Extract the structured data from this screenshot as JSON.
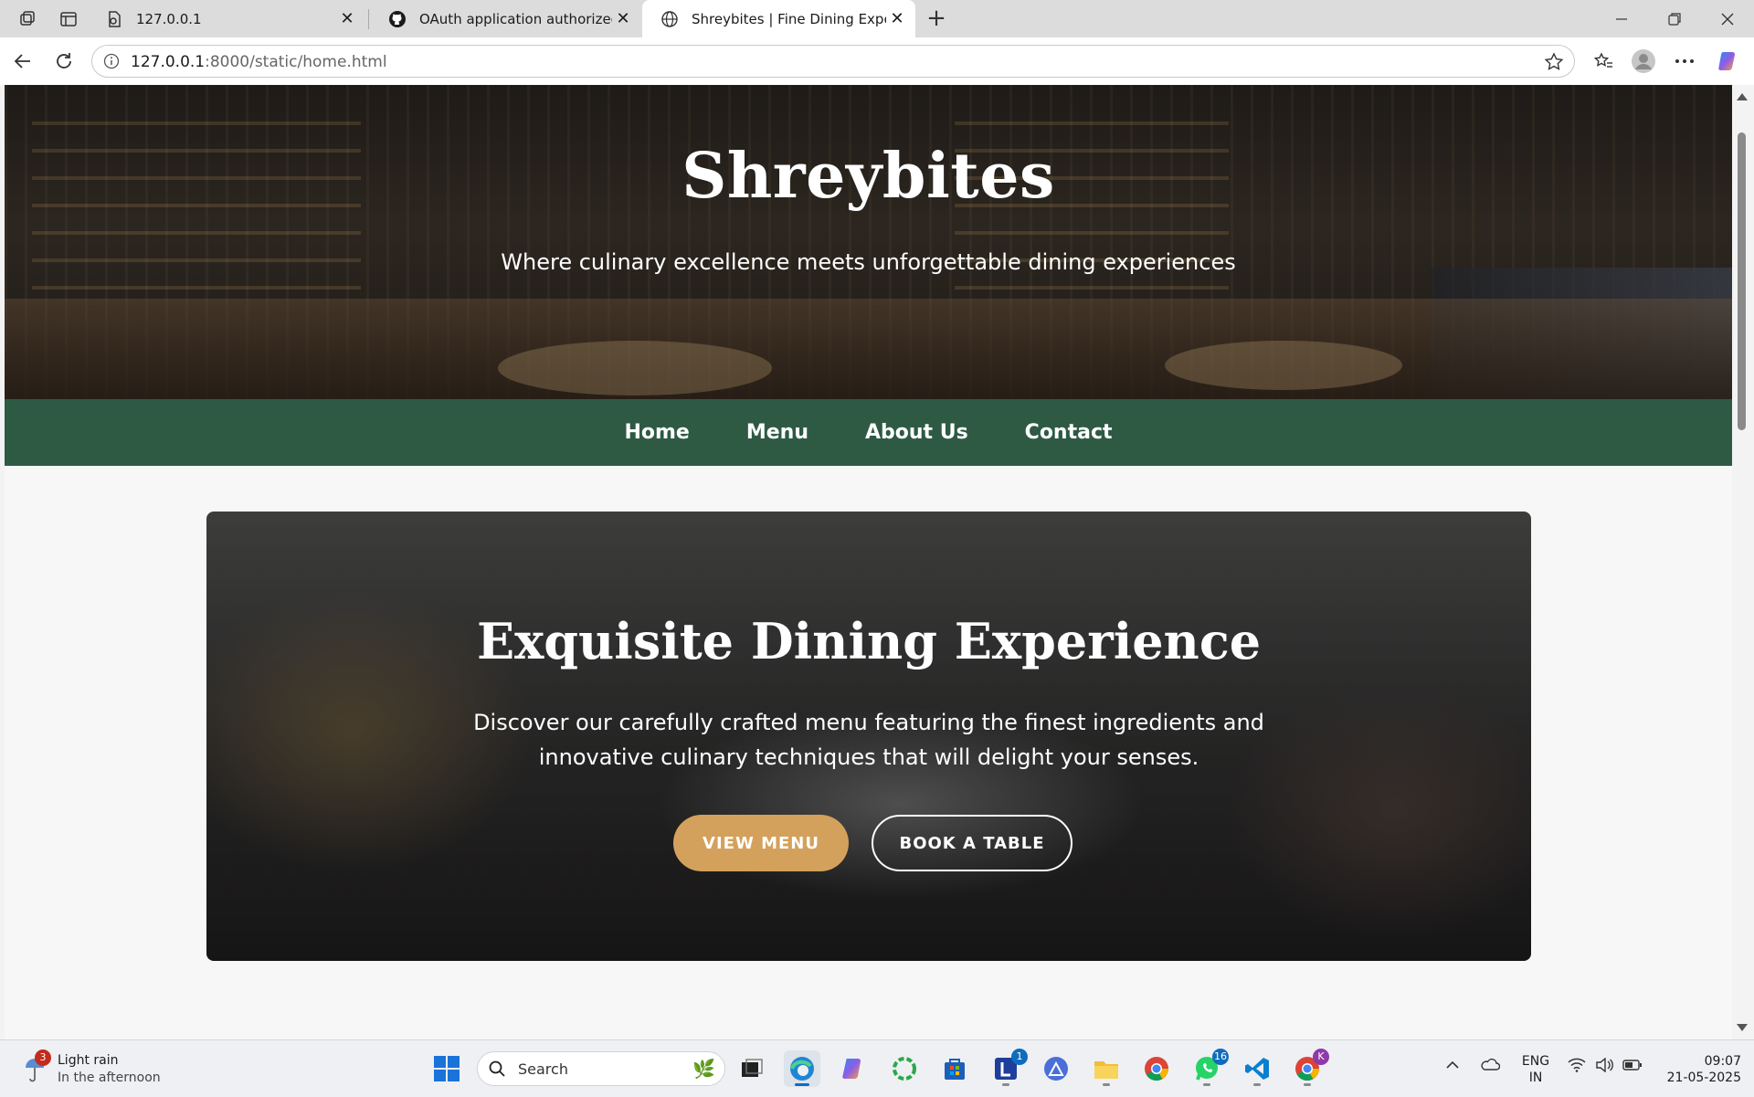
{
  "browser": {
    "tabs": [
      {
        "title": "127.0.0.1",
        "icon": "pdf-document-icon"
      },
      {
        "title": "OAuth application authorized",
        "icon": "github-icon"
      },
      {
        "title": "Shreybites | Fine Dining Experienc",
        "icon": "globe-icon",
        "active": true
      }
    ],
    "url_host": "127.0.0.1",
    "url_path": ":8000/static/home.html"
  },
  "page": {
    "hero": {
      "title": "Shreybites",
      "tagline": "Where culinary excellence meets unforgettable dining experiences"
    },
    "nav": [
      "Home",
      "Menu",
      "About Us",
      "Contact"
    ],
    "feature": {
      "title": "Exquisite Dining Experience",
      "description": "Discover our carefully crafted menu featuring the finest ingredients and innovative culinary techniques that will delight your senses.",
      "primary_button": "VIEW MENU",
      "secondary_button": "BOOK A TABLE"
    },
    "colors": {
      "nav_bg": "#2e5a44",
      "primary_button": "#d4a15c"
    }
  },
  "taskbar": {
    "weather": {
      "badge": "3",
      "line1": "Light rain",
      "line2": "In the afternoon"
    },
    "search_placeholder": "Search",
    "badges": {
      "l_app": "1",
      "whatsapp": "16",
      "profile": "K"
    },
    "lang_line1": "ENG",
    "lang_line2": "IN",
    "time": "09:07",
    "date": "21-05-2025"
  }
}
